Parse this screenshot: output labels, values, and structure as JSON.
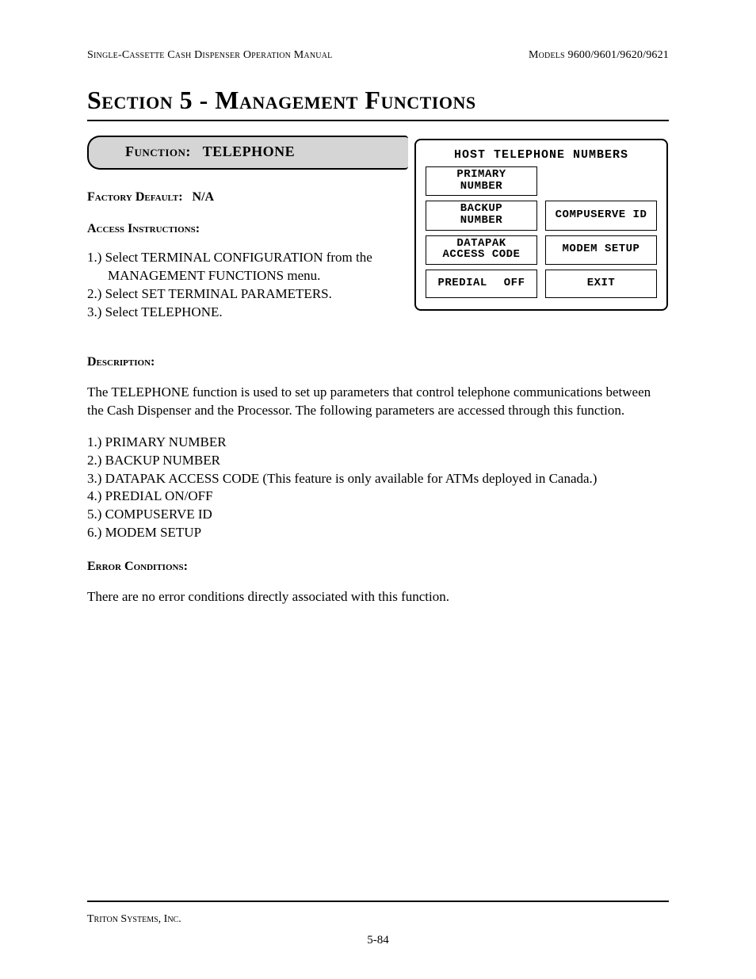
{
  "header": {
    "left": "Single-Cassette Cash Dispenser Operation Manual",
    "right": "Models 9600/9601/9620/9621"
  },
  "title": "Section 5 - Management Functions",
  "function_bar": {
    "label": "Function:",
    "value": "TELEPHONE"
  },
  "factory_default": {
    "label": "Factory Default:",
    "value": "N/A"
  },
  "access": {
    "label": "Access Instructions:",
    "items": [
      {
        "num": "1.) ",
        "text": "Select TERMINAL CONFIGURATION from the MANAGEMENT FUNCTIONS menu."
      },
      {
        "num": "2.) ",
        "text": "Select SET TERMINAL PARAMETERS."
      },
      {
        "num": "3.) ",
        "text": "Select TELEPHONE."
      }
    ]
  },
  "screen": {
    "title": "HOST TELEPHONE NUMBERS",
    "buttons": {
      "primary": {
        "line1": "PRIMARY",
        "line2": "NUMBER"
      },
      "backup": {
        "line1": "BACKUP",
        "line2": "NUMBER"
      },
      "compuserve": "COMPUSERVE ID",
      "datapak": {
        "line1": "DATAPAK",
        "line2": "ACCESS CODE"
      },
      "modem": "MODEM SETUP",
      "predial": {
        "left": "PREDIAL",
        "right": "OFF"
      },
      "exit": "EXIT"
    }
  },
  "description": {
    "label": "Description:",
    "para": "The TELEPHONE function is used to set up parameters that control telephone communications between the Cash Dispenser and the Processor.  The following parameters are accessed through this function.",
    "list": [
      "1.) PRIMARY NUMBER",
      "2.) BACKUP NUMBER",
      "3.) DATAPAK ACCESS CODE (This feature is only available for ATMs deployed in Canada.)",
      "4.) PREDIAL ON/OFF",
      "5.) COMPUSERVE ID",
      "6.) MODEM SETUP"
    ]
  },
  "error": {
    "label": "Error Conditions:",
    "text": "There are no error conditions directly associated with this function."
  },
  "footer": {
    "company": "Triton Systems, Inc.",
    "page": "5-84"
  }
}
